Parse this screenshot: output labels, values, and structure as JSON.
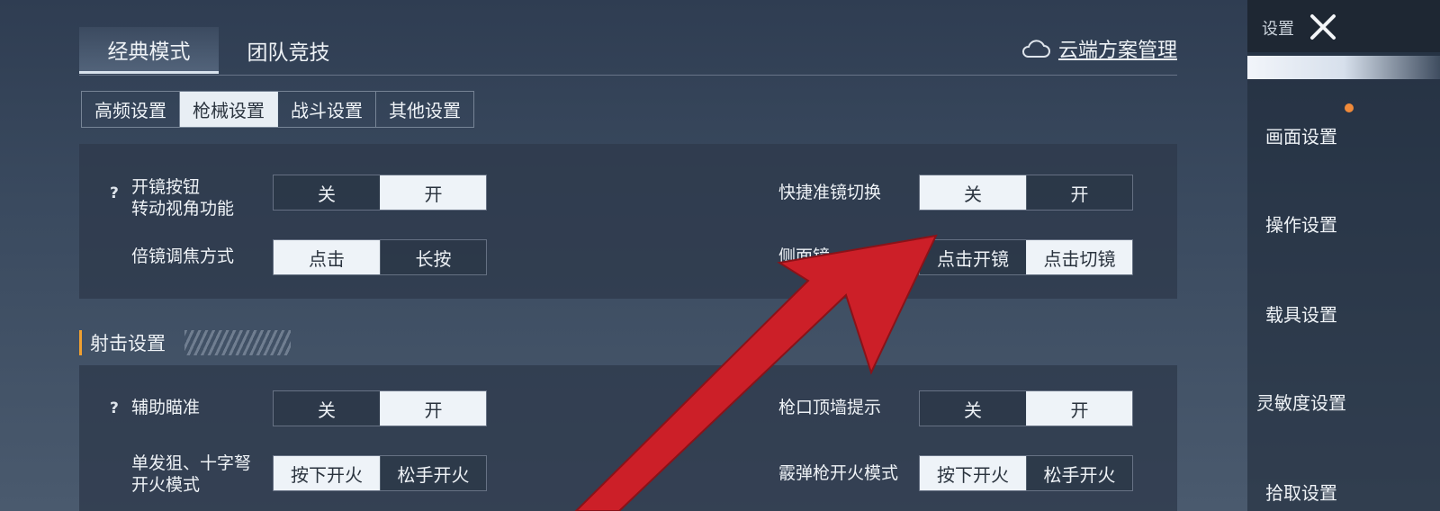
{
  "mode_tabs": [
    "经典模式",
    "团队竞技"
  ],
  "cloud_label": "云端方案管理",
  "sub_tabs": [
    "高频设置",
    "枪械设置",
    "战斗设置",
    "其他设置"
  ],
  "panel1": {
    "scope_button_label": [
      "开镜按钮",
      "转动视角功能"
    ],
    "scope_button_options": [
      "关",
      "开"
    ],
    "quick_scope_label": "快捷准镜切换",
    "quick_scope_options": [
      "关",
      "开"
    ],
    "zoom_focus_label": "倍镜调焦方式",
    "zoom_focus_options": [
      "点击",
      "长按"
    ],
    "side_scope_label": "侧面镜",
    "side_scope_options": [
      "点击开镜",
      "点击切镜"
    ]
  },
  "section_title": "射击设置",
  "panel2": {
    "aim_assist_label": "辅助瞄准",
    "aim_assist_options": [
      "关",
      "开"
    ],
    "muzzle_wall_label": "枪口顶墙提示",
    "muzzle_wall_options": [
      "关",
      "开"
    ],
    "single_shot_label": [
      "单发狙、十字弩",
      "开火模式"
    ],
    "single_shot_options": [
      "按下开火",
      "松手开火"
    ],
    "shotgun_label": "霰弹枪开火模式",
    "shotgun_options": [
      "按下开火",
      "松手开火"
    ]
  },
  "sidebar": {
    "title": "设置",
    "items": [
      "画面设置",
      "操作设置",
      "载具设置",
      "灵敏度设置",
      "拾取设置"
    ]
  },
  "qmark": "?",
  "colors": {
    "accent_orange": "#f0a030",
    "arrow_red": "#cc1f28",
    "notify_dot": "#f08a3a"
  }
}
